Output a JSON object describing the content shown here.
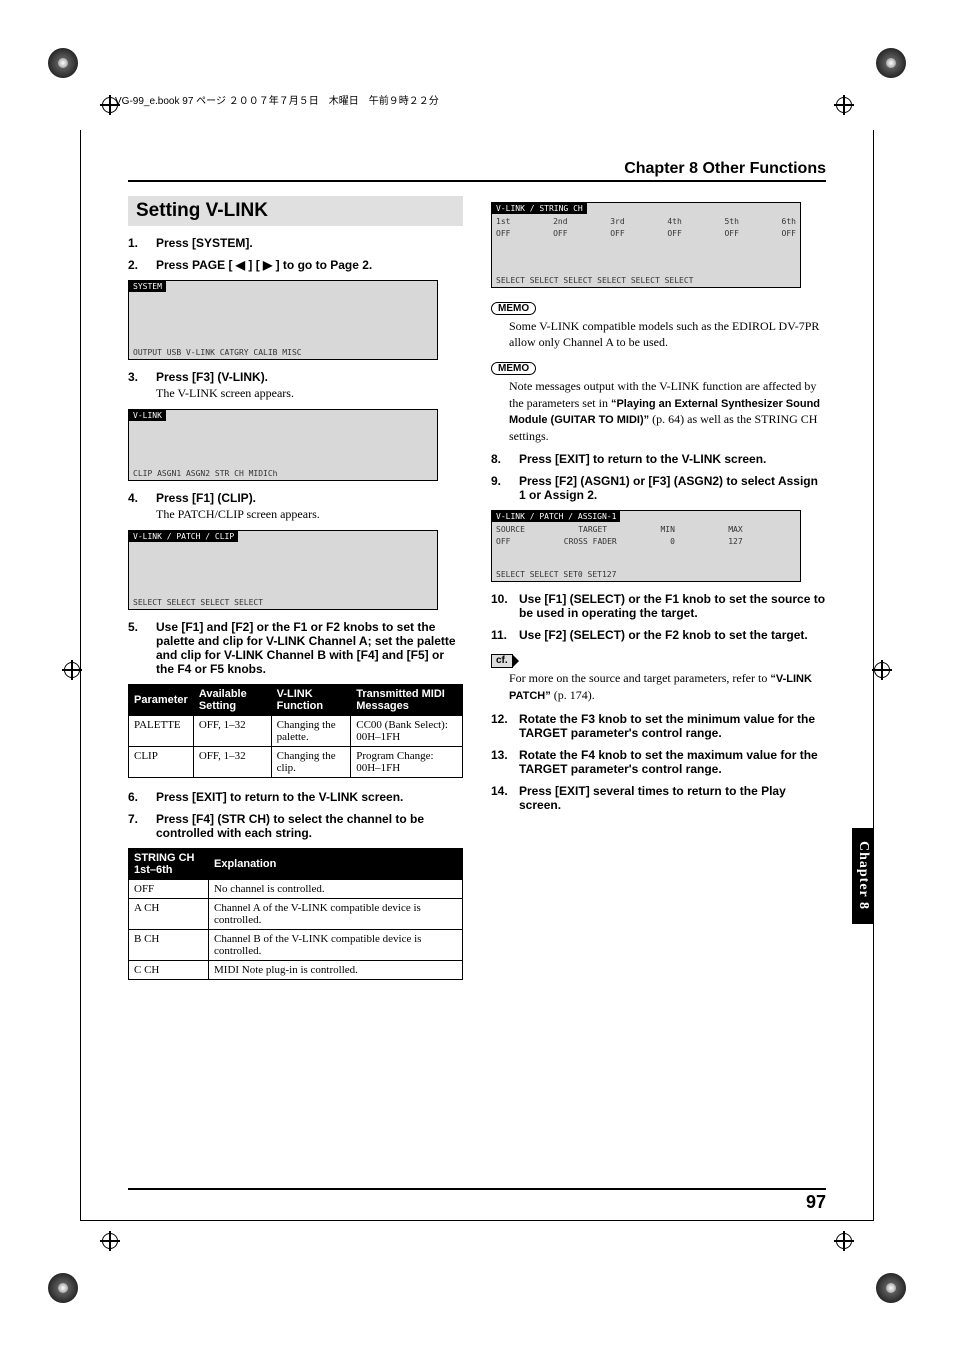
{
  "bookline": "VG-99_e.book 97 ページ ２００７年７月５日　木曜日　午前９時２２分",
  "chapter_header": "Chapter 8 Other Functions",
  "section_title": "Setting V-LINK",
  "side_tab": "Chapter 8",
  "page_number": "97",
  "left": {
    "s1": {
      "num": "1.",
      "lead": "Press [SYSTEM]."
    },
    "s2": {
      "num": "2.",
      "lead": "Press PAGE [ ◀ ] [ ▶ ] to go to Page 2."
    },
    "shot1_tab": "SYSTEM",
    "shot1_text": "OUTPUT  USB  V-LINK  CATGRY  CALIB  MISC",
    "s3": {
      "num": "3.",
      "lead": "Press [F3] (V-LINK).",
      "sub": "The V-LINK screen appears."
    },
    "shot2_tab": "V-LINK",
    "shot2_text": "CLIP  ASGN1  ASGN2  STR CH        MIDICh",
    "s4": {
      "num": "4.",
      "lead": "Press [F1] (CLIP).",
      "sub": "The PATCH/CLIP screen appears."
    },
    "shot3_tab": "V-LINK / PATCH / CLIP",
    "shot3_text": "SELECT SELECT          SELECT SELECT",
    "s5": {
      "num": "5.",
      "lead": "Use [F1] and [F2] or the F1 or F2 knobs to set the palette and clip for V-LINK Channel A; set the palette and clip for V-LINK Channel B with [F4] and [F5] or the F4 or F5 knobs."
    },
    "table1": {
      "h1": "Parameter",
      "h2": "Available Setting",
      "h3": "V-LINK Function",
      "h4": "Transmitted MIDI Messages",
      "r1c1": "PALETTE",
      "r1c2": "OFF, 1–32",
      "r1c3": "Changing the palette.",
      "r1c4": "CC00 (Bank Select): 00H–1FH",
      "r2c1": "CLIP",
      "r2c2": "OFF, 1–32",
      "r2c3": "Changing the clip.",
      "r2c4": "Program Change: 00H–1FH"
    },
    "s6": {
      "num": "6.",
      "lead": "Press [EXIT] to return to the V-LINK screen."
    },
    "s7": {
      "num": "7.",
      "lead": "Press [F4] (STR CH) to select the channel to be controlled with each string."
    },
    "table2": {
      "h1": "STRING CH 1st–6th",
      "h2": "Explanation",
      "r1c1": "OFF",
      "r1c2": "No channel is controlled.",
      "r2c1": "A CH",
      "r2c2": "Channel A of the V-LINK compatible device is controlled.",
      "r3c1": "B CH",
      "r3c2": "Channel B of the V-LINK compatible device is controlled.",
      "r4c1": "C CH",
      "r4c2": "MIDI Note plug-in is controlled."
    }
  },
  "right": {
    "shot1_tab": "V-LINK / STRING CH",
    "shot1_text": "SELECT SELECT SELECT SELECT SELECT SELECT",
    "memo_label": "MEMO",
    "memo1": "Some V-LINK compatible models such as the EDIROL DV-7PR allow only Channel A to be used.",
    "memo2a": "Note messages output with the V-LINK function are affected by the parameters set in ",
    "memo2b": "“Playing an External Synthesizer Sound Module (GUITAR TO MIDI)”",
    "memo2c": " (p. 64) as well as the STRING CH settings.",
    "s8": {
      "num": "8.",
      "lead": "Press [EXIT] to return to the V-LINK screen."
    },
    "s9": {
      "num": "9.",
      "lead": "Press [F2] (ASGN1) or [F3] (ASGN2) to select Assign 1 or Assign 2."
    },
    "shot2_tab": "V-LINK / PATCH / ASSIGN-1",
    "shot2_text": "SELECT SELECT  SET0  SET127",
    "s10": {
      "num": "10.",
      "lead": "Use [F1] (SELECT) or the F1 knob to set the source to be used in operating the target."
    },
    "s11": {
      "num": "11.",
      "lead": "Use [F2] (SELECT) or the F2 knob to set the target."
    },
    "cf_label": "cf.",
    "cf_text_a": "For more on the source and target parameters, refer to ",
    "cf_text_b": "“V-LINK PATCH”",
    "cf_text_c": " (p. 174).",
    "s12": {
      "num": "12.",
      "lead": "Rotate the F3 knob to set the minimum value for the TARGET parameter's control range."
    },
    "s13": {
      "num": "13.",
      "lead": "Rotate the F4 knob to set the maximum value for the TARGET parameter's control range."
    },
    "s14": {
      "num": "14.",
      "lead": "Press [EXIT] several times to return to the Play screen."
    }
  }
}
